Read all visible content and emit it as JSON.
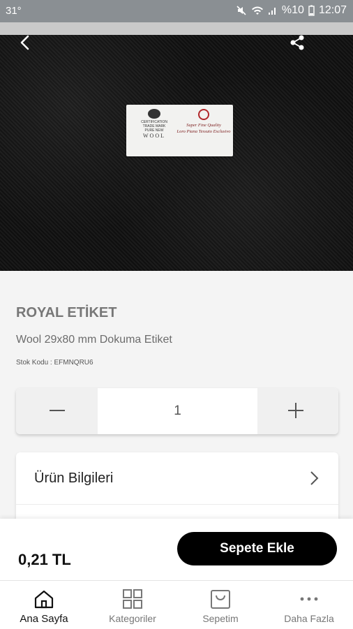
{
  "status_bar": {
    "temperature": "31°",
    "battery": "%10",
    "time": "12:07"
  },
  "product_image": {
    "label_left_lines": [
      "CERTIFICATION",
      "TRADE MARK",
      "PURE NEW"
    ],
    "label_left_wool": "WOOL",
    "label_right_lines": [
      "Super Fine Quality",
      "Loro Piana Tessuto Esclusivo"
    ]
  },
  "product": {
    "brand": "ROYAL ETİKET",
    "name": "Wool 29x80 mm Dokuma Etiket",
    "sku": "Stok Kodu : EFMNQRU6",
    "quantity": "1",
    "info_label": "Ürün Bilgileri"
  },
  "purchase": {
    "price": "0,21 TL",
    "add_to_cart": "Sepete Ekle"
  },
  "bottom_nav": [
    {
      "label": "Ana Sayfa",
      "icon": "home-icon",
      "active": true
    },
    {
      "label": "Kategoriler",
      "icon": "grid-icon",
      "active": false
    },
    {
      "label": "Sepetim",
      "icon": "cart-icon",
      "active": false
    },
    {
      "label": "Daha Fazla",
      "icon": "more-icon",
      "active": false
    }
  ]
}
